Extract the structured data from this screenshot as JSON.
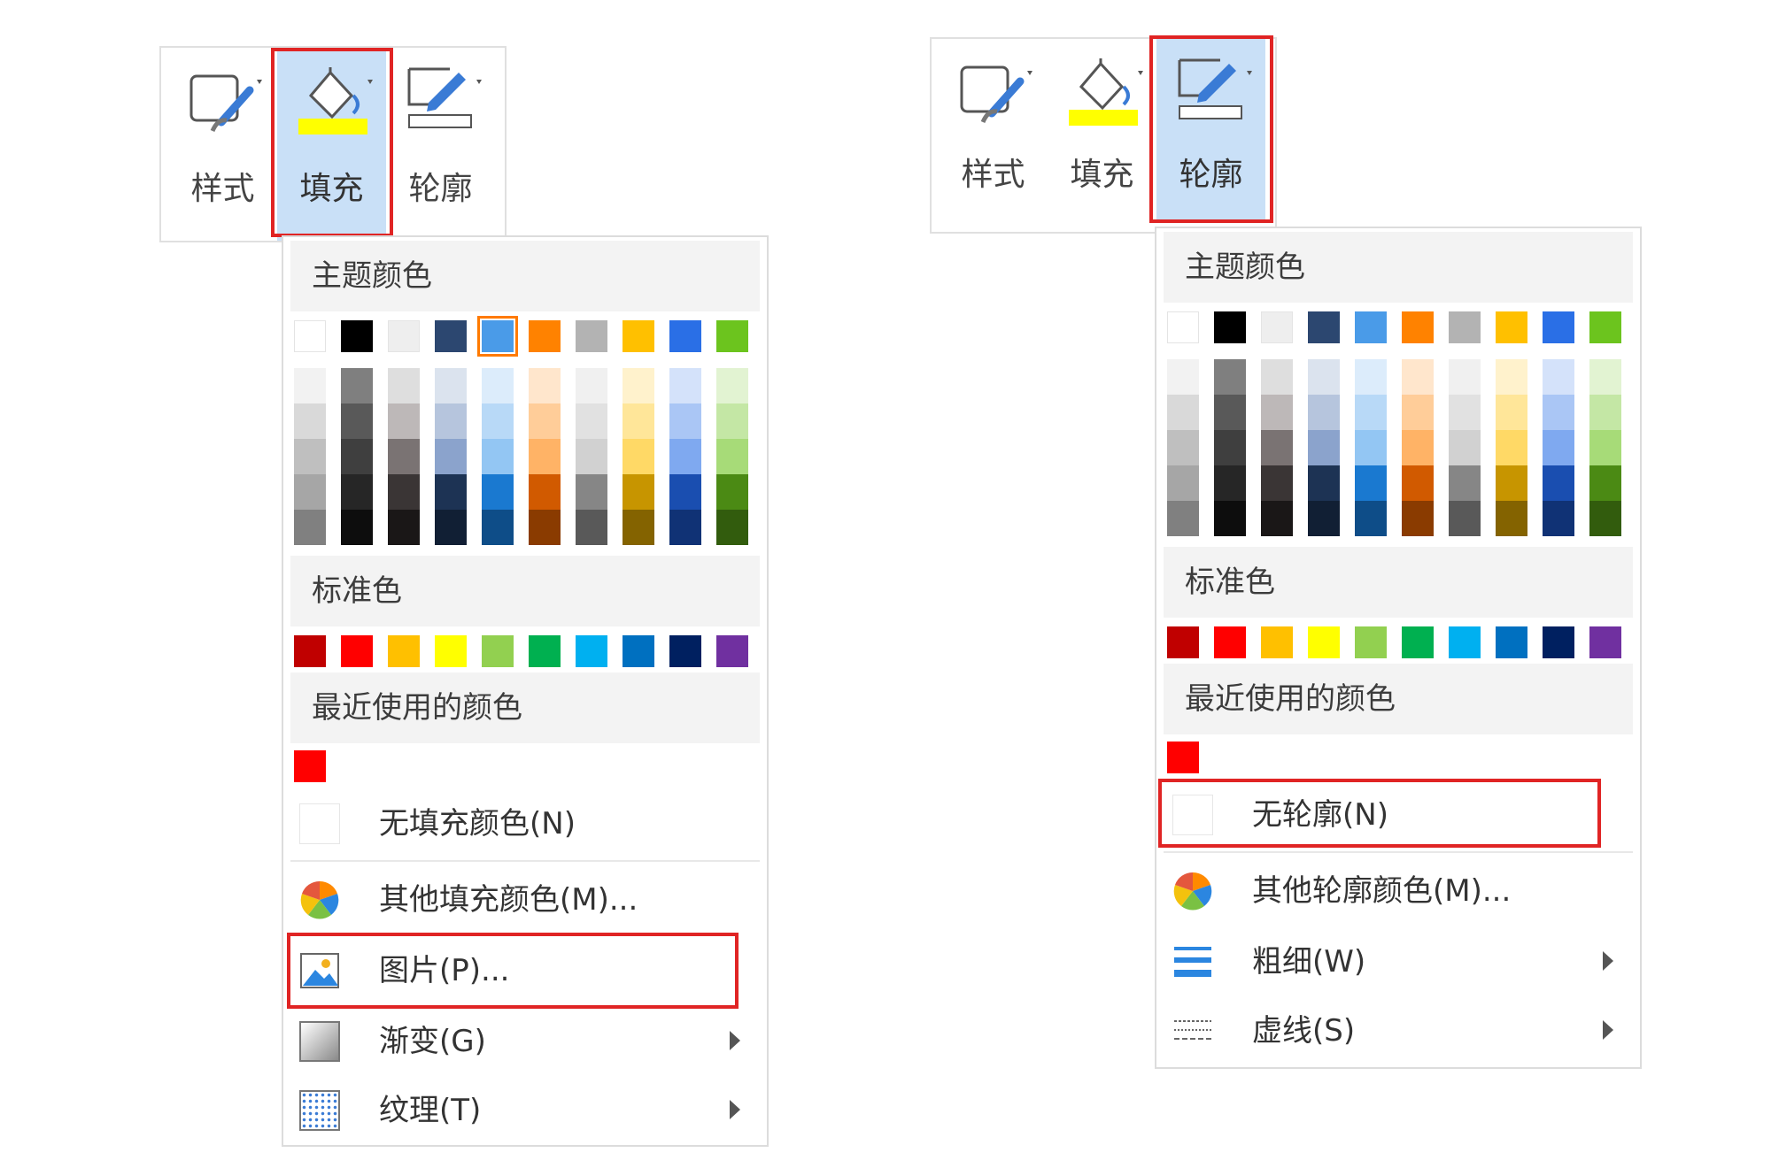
{
  "toolbar": {
    "style_label": "样式",
    "fill_label": "填充",
    "outline_label": "轮廓",
    "fill_bar_color": "#ffff00",
    "active_bg": "#c9e0f7",
    "highlight_color": "#e02424"
  },
  "fill_menu": {
    "theme_title": "主题颜色",
    "standard_title": "标准色",
    "recent_title": "最近使用的颜色",
    "no_fill": "无填充颜色(N)",
    "more_colors": "其他填充颜色(M)...",
    "picture": "图片(P)...",
    "gradient": "渐变(G)",
    "texture": "纹理(T)"
  },
  "outline_menu": {
    "theme_title": "主题颜色",
    "standard_title": "标准色",
    "recent_title": "最近使用的颜色",
    "no_outline": "无轮廓(N)",
    "more_colors": "其他轮廓颜色(M)...",
    "weight": "粗细(W)",
    "dash": "虚线(S)"
  },
  "palette": {
    "theme": [
      "#ffffff",
      "#000000",
      "#eeeeee",
      "#2c4770",
      "#4a9be8",
      "#ff8200",
      "#b3b3b3",
      "#ffc000",
      "#2a6fe6",
      "#6cc41e"
    ],
    "shades": [
      [
        "#f2f2f2",
        "#d9d9d9",
        "#bfbfbf",
        "#a6a6a6",
        "#808080"
      ],
      [
        "#7f7f7f",
        "#595959",
        "#3f3f3f",
        "#262626",
        "#0d0d0d"
      ],
      [
        "#dedede",
        "#bdb8b8",
        "#7a7373",
        "#3a3535",
        "#1a1717"
      ],
      [
        "#dbe3ee",
        "#b6c5dd",
        "#8ba3cc",
        "#1d3354",
        "#111f34"
      ],
      [
        "#dcecfb",
        "#b8d9f7",
        "#93c6f3",
        "#1a79d0",
        "#0e4d88"
      ],
      [
        "#ffe6cc",
        "#ffcd99",
        "#ffb366",
        "#d15a00",
        "#8a3b00"
      ],
      [
        "#f0f0f0",
        "#e1e1e1",
        "#d1d1d1",
        "#868686",
        "#595959"
      ],
      [
        "#fff2cc",
        "#ffe699",
        "#ffd966",
        "#c79500",
        "#846300"
      ],
      [
        "#d4e2fa",
        "#aac6f5",
        "#7fa9f0",
        "#1a4eb0",
        "#103275"
      ],
      [
        "#e2f3d2",
        "#c4e7a5",
        "#a7db78",
        "#4b8a14",
        "#325c0d"
      ]
    ],
    "standard": [
      "#c00000",
      "#ff0000",
      "#ffc000",
      "#ffff00",
      "#92d050",
      "#00b050",
      "#00b0f0",
      "#0070c0",
      "#002060",
      "#7030a0"
    ],
    "recent": "#ff0000"
  }
}
